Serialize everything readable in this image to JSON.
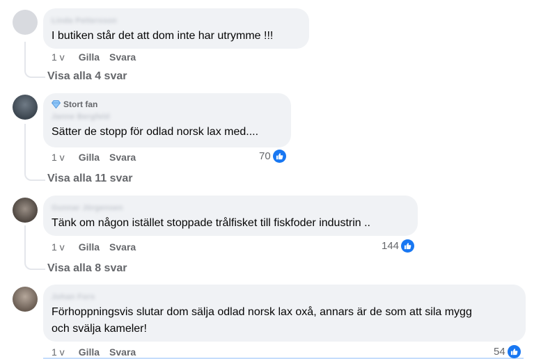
{
  "comments": [
    {
      "author": "Linda Pettersson",
      "badge": "",
      "text": "I butiken står det att dom inte har utrymme !!!",
      "time": "1 v",
      "like_label": "Gilla",
      "reply_label": "Svara",
      "likes": "",
      "view_replies": "Visa alla 4 svar",
      "avatar_color": "#d8dadf"
    },
    {
      "author": "Janne Bergfeld",
      "badge": "Stort fan",
      "text": "Sätter de stopp för odlad norsk lax med....",
      "time": "1 v",
      "like_label": "Gilla",
      "reply_label": "Svara",
      "likes": "70",
      "view_replies": "Visa alla 11 svar",
      "avatar_color": "#4a5560"
    },
    {
      "author": "Gunnar Jörgensen",
      "badge": "",
      "text": "Tänk om någon istället stoppade trålfisket till fiskfoder industrin ..",
      "time": "1 v",
      "like_label": "Gilla",
      "reply_label": "Svara",
      "likes": "144",
      "view_replies": "Visa alla 8 svar",
      "avatar_color": "#6b625a"
    },
    {
      "author": "Johan Fors",
      "badge": "",
      "text_line1": "Förhoppningsvis slutar dom sälja odlad norsk lax oxå, annars är de som att sila mygg",
      "text_line2": "och svälja kameler!",
      "time": "1 v",
      "like_label": "Gilla",
      "reply_label": "Svara",
      "likes": "54",
      "avatar_color": "#7a6f66"
    }
  ],
  "colors": {
    "bubble": "#f0f2f5",
    "like_blue": "#1877f2",
    "meta_gray": "#65676b"
  },
  "icons": [
    "like-thumb-icon",
    "diamond-badge-icon"
  ]
}
